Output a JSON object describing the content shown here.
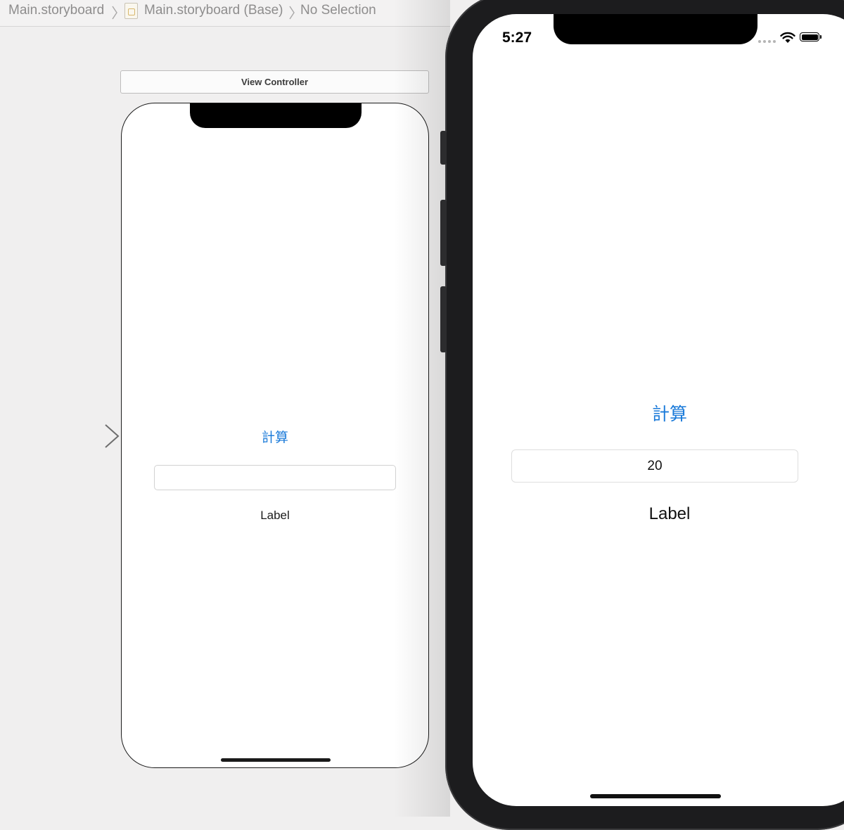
{
  "breadcrumb": {
    "items": [
      "Main.storyboard",
      "Main.storyboard (Base)",
      "No Selection"
    ]
  },
  "storyboard": {
    "scene_title": "View Controller",
    "button_label": "計算",
    "text_field_value": "",
    "label_text": "Label"
  },
  "simulator": {
    "status_time": "5:27",
    "button_label": "計算",
    "text_field_value": "20",
    "label_text": "Label"
  },
  "colors": {
    "tint": "#1a7ad9",
    "canvas": "#f0efef",
    "device_bezel": "#1c1c1e"
  },
  "icons": [
    "file-storyboard-icon",
    "chevron-right-icon",
    "entry-point-arrow-icon",
    "wifi-icon",
    "battery-icon",
    "cellular-signal-icon"
  ]
}
